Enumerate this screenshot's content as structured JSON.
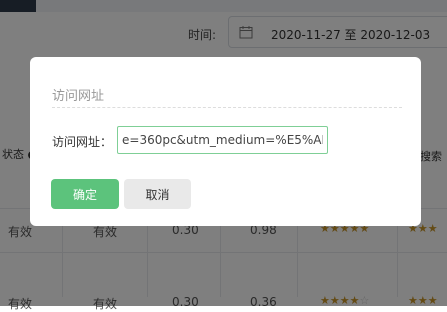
{
  "header": {
    "time_label": "时间:",
    "date_range": "2020-11-27 至 2020-12-03",
    "calendar_icon": "calendar-icon"
  },
  "background": {
    "left_header_fragment": "状态",
    "right_header_fragment": "搜索",
    "rows": [
      {
        "status": "有效",
        "status2": "有效",
        "value1": "0.30",
        "value2": "0.98",
        "rating": 5
      },
      {
        "status": "有效",
        "status2": "有效",
        "value1": "0.30",
        "value2": "0.36",
        "rating": 4
      }
    ]
  },
  "dialog": {
    "title": "访问网址",
    "url_label": "访问网址：",
    "url_value": "e=360pc&utm_medium=%E5%AD%",
    "ok_label": "确定",
    "cancel_label": "取消",
    "accent_color": "#5cc37c"
  }
}
